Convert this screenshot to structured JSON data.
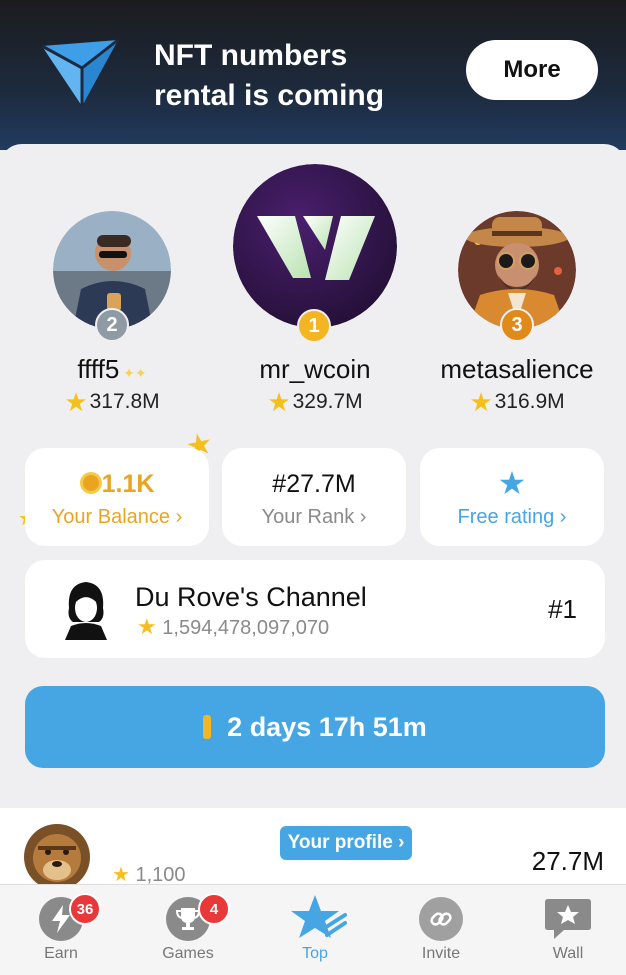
{
  "banner": {
    "text_line1": "NFT numbers",
    "text_line2": "rental is coming",
    "more_label": "More"
  },
  "podium": [
    {
      "rank": "2",
      "name": "ffff5",
      "score": "317.8M",
      "badge_color": "#8f9aa5"
    },
    {
      "rank": "1",
      "name": "mr_wcoin",
      "score": "329.7M",
      "badge_color": "#f4b523"
    },
    {
      "rank": "3",
      "name": "metasalience",
      "score": "316.9M",
      "badge_color": "#e08a1a"
    }
  ],
  "stats": {
    "balance": {
      "value": "1.1K",
      "label": "Your Balance ›"
    },
    "rank": {
      "value": "#27.7M",
      "label": "Your Rank ›"
    },
    "rating": {
      "label": "Free rating ›"
    }
  },
  "channel": {
    "name": "Du Rove's Channel",
    "score": "1,594,478,097,070",
    "rank": "#1"
  },
  "timer": {
    "label": "2 days 17h 51m"
  },
  "profile": {
    "button_label": "Your profile ›",
    "score": "1,100",
    "rank": "27.7M"
  },
  "nav": [
    {
      "label": "Earn",
      "badge": "36",
      "icon": "lightning-icon"
    },
    {
      "label": "Games",
      "badge": "4",
      "icon": "trophy-icon"
    },
    {
      "label": "Top",
      "badge": "",
      "icon": "star-icon"
    },
    {
      "label": "Invite",
      "badge": "",
      "icon": "link-icon"
    },
    {
      "label": "Wall",
      "badge": "",
      "icon": "chat-star-icon"
    }
  ],
  "colors": {
    "accent_blue": "#46a6e3",
    "gold": "#f4b523",
    "badge_red": "#e8383a"
  }
}
